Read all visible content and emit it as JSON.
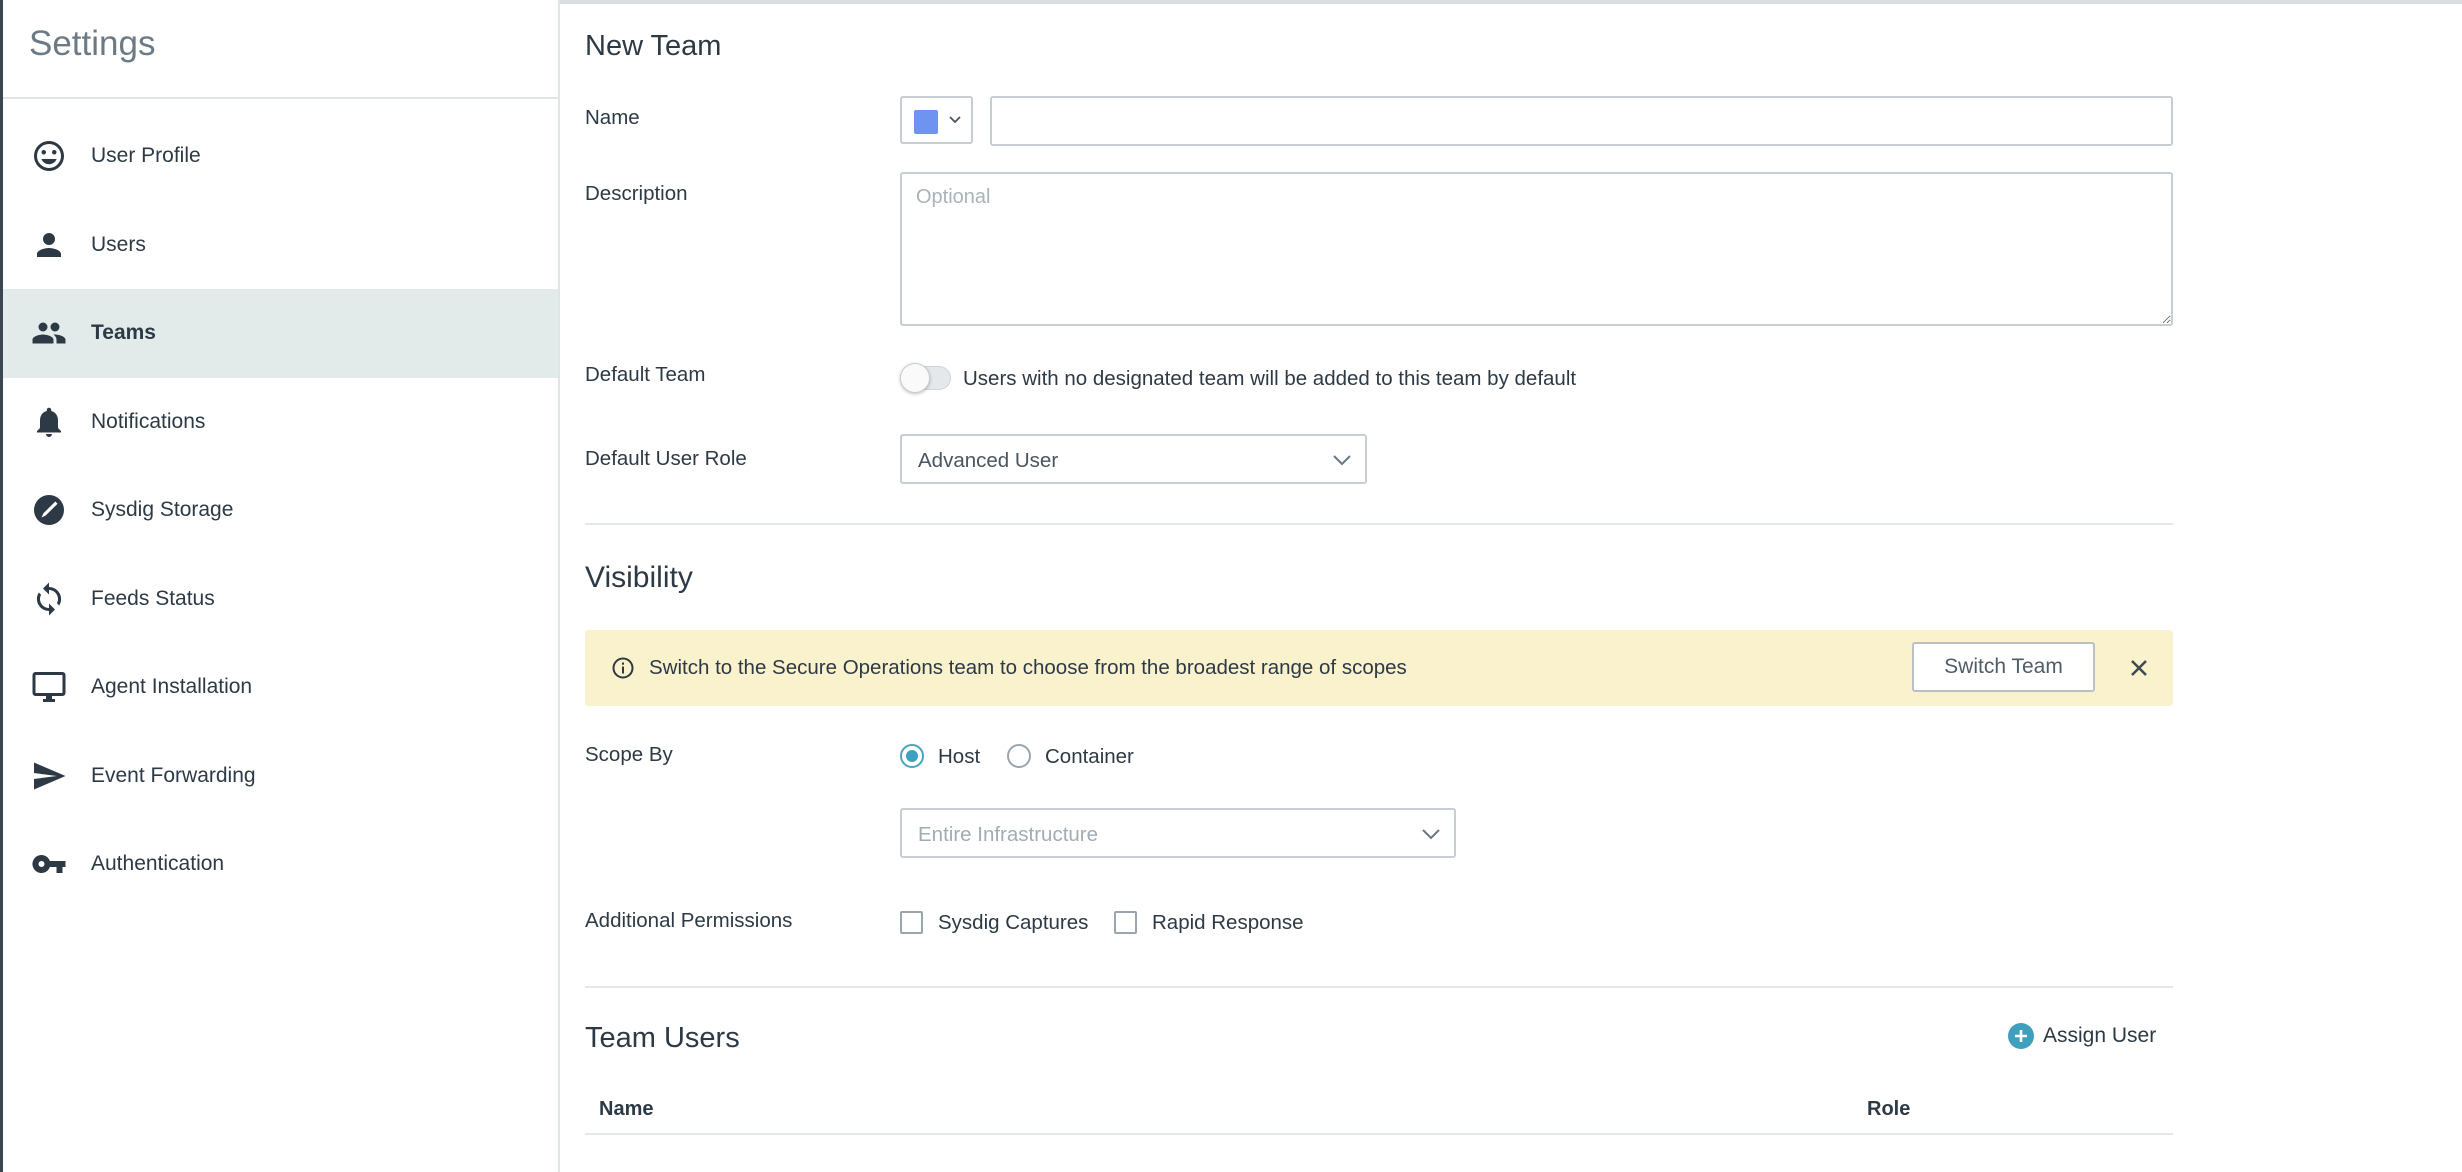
{
  "sidebar": {
    "title": "Settings",
    "items": [
      {
        "label": "User Profile",
        "icon": "smiley-icon"
      },
      {
        "label": "Users",
        "icon": "person-icon"
      },
      {
        "label": "Teams",
        "icon": "people-icon",
        "active": true
      },
      {
        "label": "Notifications",
        "icon": "bell-icon"
      },
      {
        "label": "Sysdig Storage",
        "icon": "storage-icon"
      },
      {
        "label": "Feeds Status",
        "icon": "sync-icon"
      },
      {
        "label": "Agent Installation",
        "icon": "monitor-icon"
      },
      {
        "label": "Event Forwarding",
        "icon": "send-icon"
      },
      {
        "label": "Authentication",
        "icon": "key-icon"
      }
    ]
  },
  "form": {
    "title": "New Team",
    "name_label": "Name",
    "name_value": "",
    "team_color": "#6f93f0",
    "description_label": "Description",
    "description_placeholder": "Optional",
    "default_team_label": "Default Team",
    "default_team_text": "Users with no designated team will be added to this team by default",
    "default_team_on": false,
    "default_role_label": "Default User Role",
    "default_role_value": "Advanced User"
  },
  "visibility": {
    "title": "Visibility",
    "banner_text": "Switch to the Secure Operations team to choose from the broadest range of scopes",
    "switch_button": "Switch Team",
    "scope_label": "Scope By",
    "scope_options": [
      "Host",
      "Container"
    ],
    "scope_selected": "Host",
    "scope_select_placeholder": "Entire Infrastructure",
    "permissions_label": "Additional Permissions",
    "permissions": [
      "Sysdig Captures",
      "Rapid Response"
    ]
  },
  "team_users": {
    "title": "Team Users",
    "assign_label": "Assign User",
    "columns": [
      "Name",
      "Role"
    ]
  },
  "colors": {
    "accent": "#3f9fbf",
    "active_nav_bg": "#e2ebea",
    "banner_bg": "#faf1cd"
  }
}
